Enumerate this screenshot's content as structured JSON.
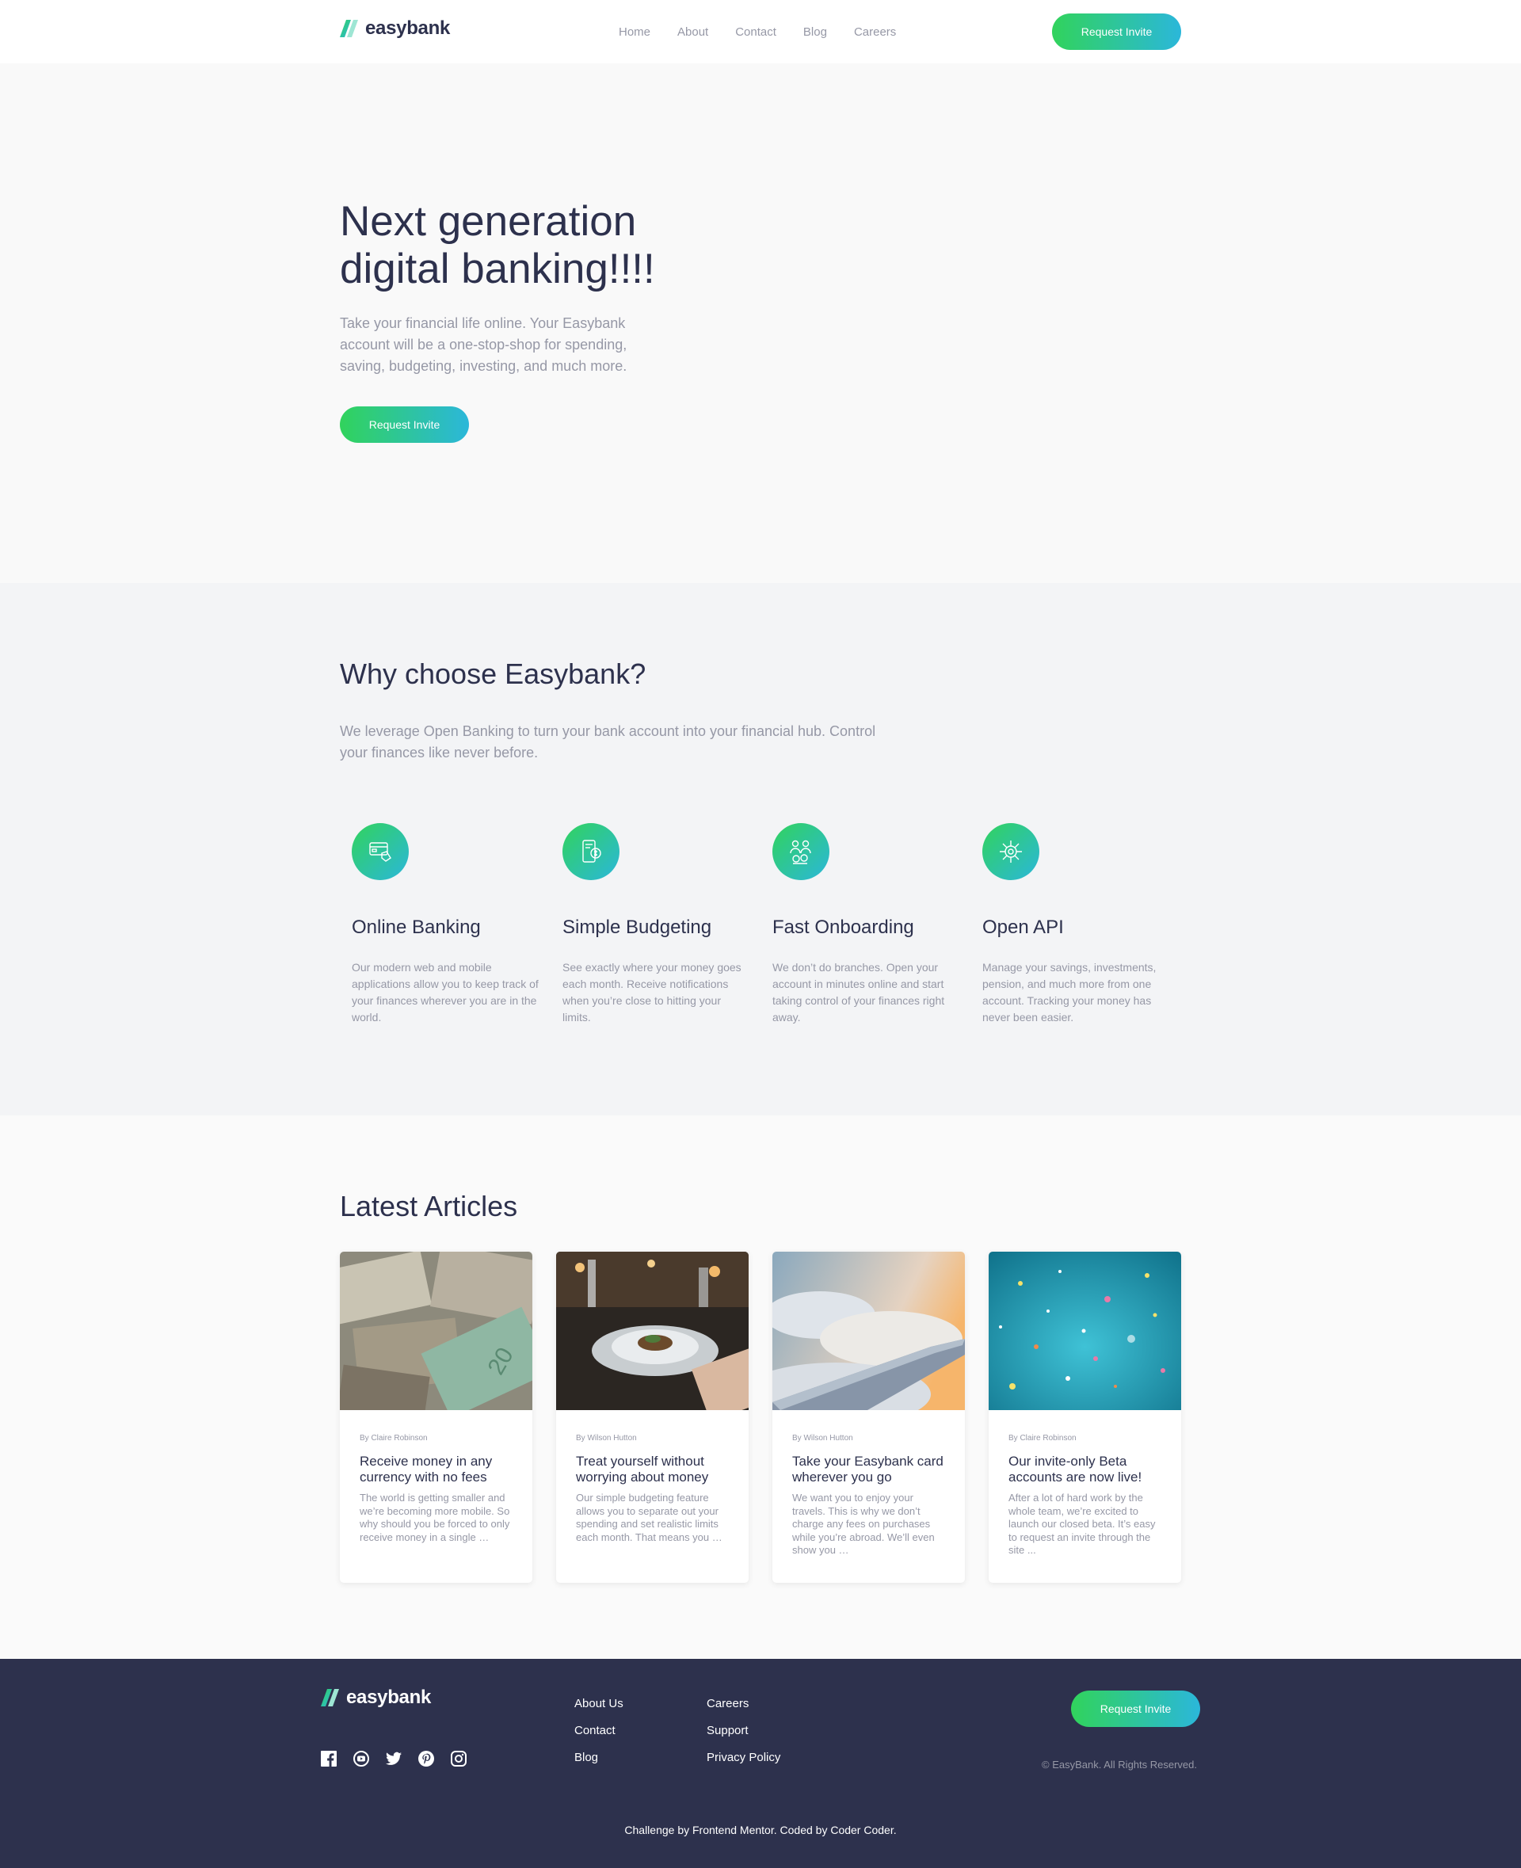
{
  "brand": {
    "name": "easybank",
    "colors": {
      "dark_blue": "#2d314d",
      "lime_green": "#31d35c",
      "bright_cyan": "#2bb7da",
      "grayish_blue": "#9698a6"
    }
  },
  "header": {
    "nav": [
      "Home",
      "About",
      "Contact",
      "Blog",
      "Careers"
    ],
    "cta_label": "Request Invite"
  },
  "hero": {
    "title": "Next generation digital banking!!!!",
    "text": "Take your financial life online. Your Easybank account will be a one-stop-shop for spending, saving, budgeting, investing, and much more.",
    "cta_label": "Request Invite"
  },
  "why": {
    "title": "Why choose Easybank?",
    "text": "We leverage Open Banking to turn your bank account into your financial hub. Control your finances like never before.",
    "features": [
      {
        "icon": "online-banking-icon",
        "title": "Online Banking",
        "text": "Our modern web and mobile applications allow you to keep track of your finances wherever you are in the world."
      },
      {
        "icon": "budgeting-icon",
        "title": "Simple Budgeting",
        "text": "See exactly where your money goes each month. Receive notifications when you’re close to hitting your limits."
      },
      {
        "icon": "onboarding-icon",
        "title": "Fast Onboarding",
        "text": "We don’t do branches. Open your account in minutes online and start taking control of your finances right away."
      },
      {
        "icon": "api-icon",
        "title": "Open API",
        "text": "Manage your savings, investments, pension, and much more from one account. Tracking your money has never been easier."
      }
    ]
  },
  "articles": {
    "title": "Latest Articles",
    "items": [
      {
        "image": "currency-photo",
        "author": "By Claire Robinson",
        "title": "Receive money in any currency with no fees",
        "text": "The world is getting smaller and we’re becoming more mobile. So why should you be forced to only receive money in a single …"
      },
      {
        "image": "restaurant-photo",
        "author": "By Wilson Hutton",
        "title": "Treat yourself without worrying about money",
        "text": "Our simple budgeting feature allows you to separate out your spending and set realistic limits each month. That means you …"
      },
      {
        "image": "plane-wing-photo",
        "author": "By Wilson Hutton",
        "title": "Take your Easybank card wherever you go",
        "text": "We want you to enjoy your travels. This is why we don’t charge any fees on purchases while you’re abroad. We’ll even show you …"
      },
      {
        "image": "confetti-photo",
        "author": "By Claire Robinson",
        "title": "Our invite-only Beta accounts are now live!",
        "text": "After a lot of hard work by the whole team, we’re excited to launch our closed beta. It’s easy to request an invite through the site ..."
      }
    ]
  },
  "footer": {
    "social": [
      "facebook-icon",
      "youtube-icon",
      "twitter-icon",
      "pinterest-icon",
      "instagram-icon"
    ],
    "links_col1": [
      "About Us",
      "Contact",
      "Blog"
    ],
    "links_col2": [
      "Careers",
      "Support",
      "Privacy Policy"
    ],
    "cta_label": "Request Invite",
    "copyright": "© EasyBank. All Rights Reserved.",
    "attribution": "Challenge by Frontend Mentor. Coded by Coder Coder."
  }
}
